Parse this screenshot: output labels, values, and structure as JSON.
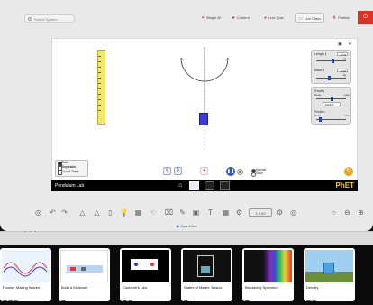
{
  "topbar": {
    "select_system": "Select System",
    "buttons": [
      {
        "label": "Bingle AI",
        "icon": "star-icon"
      },
      {
        "label": "Content",
        "icon": "folder-icon"
      },
      {
        "label": "Live Quiz",
        "icon": "quiz-icon"
      },
      {
        "label": "Live Class",
        "icon": "class-icon"
      },
      {
        "label": "Publish",
        "icon": "publish-icon"
      }
    ],
    "exit_label": "⏻"
  },
  "sim": {
    "title": "Pendulum Lab",
    "brand": "PhET",
    "panel_length": {
      "label": "Length 1",
      "value": "0.70 m"
    },
    "panel_mass": {
      "label": "Mass 1",
      "value": "1.00 kg"
    },
    "gravity": {
      "label": "Gravity",
      "min": "None",
      "max": "Lots",
      "planet": "Earth"
    },
    "friction": {
      "label": "Friction",
      "min": "None",
      "max": "Lots"
    },
    "checks": [
      {
        "label": "Ruler",
        "on": true
      },
      {
        "label": "Stopwatch",
        "on": false
      },
      {
        "label": "Period Trace",
        "on": false
      }
    ],
    "speed": [
      {
        "label": "Normal",
        "on": true
      },
      {
        "label": "Slow",
        "on": false
      }
    ]
  },
  "toolbar": {
    "zoom_label": "1:3.00"
  },
  "monitor_brand": "GyanMitra",
  "dots": "- - -",
  "thumbnails": [
    {
      "title": "Fourier: Making Waves",
      "badges": [
        "#2d6a3a",
        "#3a7bd5",
        "#b54bd8"
      ]
    },
    {
      "title": "Build a Molecule",
      "badges": [
        "#2d6a3a"
      ]
    },
    {
      "title": "Coulomb's Law",
      "badges": [
        "#2d6a3a",
        "#3a9b4a"
      ]
    },
    {
      "title": "States of Matter: Basics",
      "badges": [
        "#2d6a3a"
      ]
    },
    {
      "title": "Blackbody Spectrum",
      "badges": [
        "#2d6a3a"
      ]
    },
    {
      "title": "Density",
      "badges": [
        "#2d6a3a",
        "#b54bd8"
      ]
    }
  ],
  "colors": {
    "accent_red": "#d93b2f",
    "phet_yellow": "#ffcc00"
  }
}
